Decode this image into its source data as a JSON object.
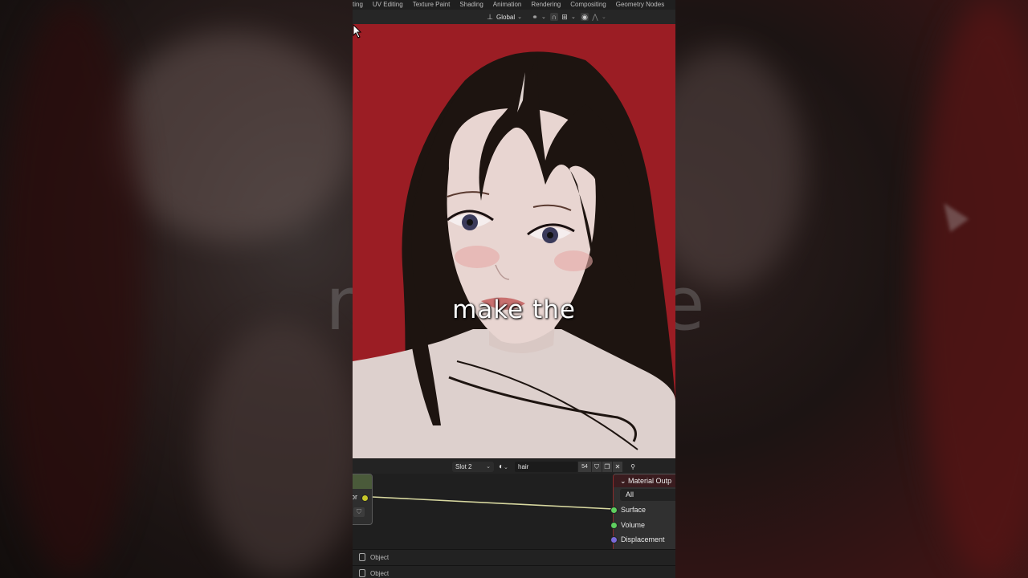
{
  "workspace_tabs": [
    "ting",
    "UV Editing",
    "Texture Paint",
    "Shading",
    "Animation",
    "Rendering",
    "Compositing",
    "Geometry Nodes"
  ],
  "toolbar": {
    "transform_orientation": "Global"
  },
  "viewport": {
    "background_color": "#9b1d24",
    "caption": "make the"
  },
  "side_backdrop": {
    "left_text": "m",
    "right_text": "e"
  },
  "node_header": {
    "slot": "Slot 2",
    "material_name": "hair",
    "user_count": "54"
  },
  "texture_node": {
    "socket_label": "olor"
  },
  "material_output": {
    "title": "Material Outp",
    "target": "All",
    "sockets": [
      {
        "label": "Surface",
        "color": "#5fcf5f"
      },
      {
        "label": "Volume",
        "color": "#5fcf5f"
      },
      {
        "label": "Displacement",
        "color": "#7a6ad8"
      }
    ]
  },
  "footer": {
    "row1": "Object",
    "row2": "Object"
  }
}
